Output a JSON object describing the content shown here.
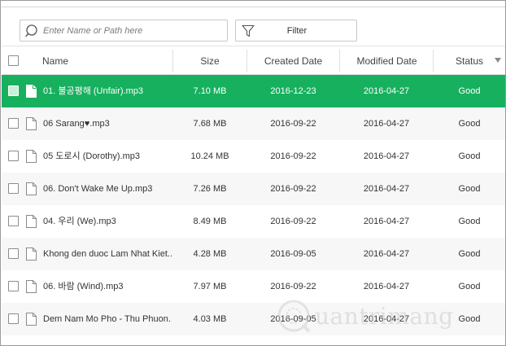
{
  "search": {
    "placeholder": "Enter Name or Path here",
    "icon": "search-icon"
  },
  "filter": {
    "label": "Filter",
    "icon": "funnel-icon"
  },
  "columns": {
    "name": "Name",
    "size": "Size",
    "created": "Created Date",
    "modified": "Modified Date",
    "status": "Status"
  },
  "rows": [
    {
      "name": "01. 불공평해 (Unfair).mp3",
      "size": "7.10 MB",
      "created": "2016-12-23",
      "modified": "2016-04-27",
      "status": "Good",
      "selected": true
    },
    {
      "name": "06 Sarang♥.mp3",
      "size": "7.68 MB",
      "created": "2016-09-22",
      "modified": "2016-04-27",
      "status": "Good",
      "selected": false
    },
    {
      "name": "05 도로시 (Dorothy).mp3",
      "size": "10.24 MB",
      "created": "2016-09-22",
      "modified": "2016-04-27",
      "status": "Good",
      "selected": false
    },
    {
      "name": "06. Don't Wake Me Up.mp3",
      "size": "7.26 MB",
      "created": "2016-09-22",
      "modified": "2016-04-27",
      "status": "Good",
      "selected": false
    },
    {
      "name": "04. 우리 (We).mp3",
      "size": "8.49 MB",
      "created": "2016-09-22",
      "modified": "2016-04-27",
      "status": "Good",
      "selected": false
    },
    {
      "name": "Khong den duoc Lam Nhat Kiet...",
      "size": "4.28 MB",
      "created": "2016-09-05",
      "modified": "2016-04-27",
      "status": "Good",
      "selected": false
    },
    {
      "name": "06. 바람 (Wind).mp3",
      "size": "7.97 MB",
      "created": "2016-09-22",
      "modified": "2016-04-27",
      "status": "Good",
      "selected": false
    },
    {
      "name": "Dem Nam Mo Pho - Thu Phuon...",
      "size": "4.03 MB",
      "created": "2016-09-05",
      "modified": "2016-04-27",
      "status": "Good",
      "selected": false
    }
  ],
  "colors": {
    "selected_row": "#17b05e",
    "alt_row": "#f7f7f7"
  },
  "watermark": {
    "text": "uantrimang"
  }
}
